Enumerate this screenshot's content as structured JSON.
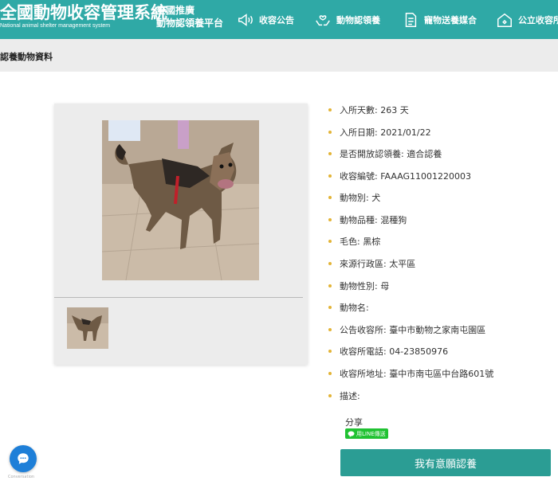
{
  "header": {
    "brand_title": "全國動物收容管理系統",
    "brand_subtitle": "National animal shelter management system",
    "slogan_line1": "全國推廣",
    "slogan_line2": "動物認領養平台",
    "nav": [
      {
        "label": "收容公告",
        "icon": "megaphone-icon"
      },
      {
        "label": "動物認領養",
        "icon": "hands-heart-icon"
      },
      {
        "label": "寵物送養媒合",
        "icon": "document-icon"
      },
      {
        "label": "公立收容所",
        "icon": "house-icon"
      }
    ],
    "colors": {
      "header_bg": "#2fa9a6",
      "button_bg": "#2b9d94",
      "bullet": "#e3b437",
      "line_green": "#20c232"
    }
  },
  "page": {
    "section_title": "認養動物資料"
  },
  "animal": {
    "fields": [
      {
        "label": "入所天數:",
        "value": "263 天"
      },
      {
        "label": "入所日期:",
        "value": "2021/01/22"
      },
      {
        "label": "是否開放認領養:",
        "value": "適合認養"
      },
      {
        "label": "收容編號:",
        "value": "FAAAG11001220003"
      },
      {
        "label": "動物別:",
        "value": "犬"
      },
      {
        "label": "動物品種:",
        "value": "混種狗"
      },
      {
        "label": "毛色:",
        "value": "黑棕"
      },
      {
        "label": "來源行政區:",
        "value": "太平區"
      },
      {
        "label": "動物性別:",
        "value": "母"
      },
      {
        "label": "動物名:",
        "value": ""
      },
      {
        "label": "公告收容所:",
        "value": "臺中市動物之家南屯園區"
      },
      {
        "label": "收容所電話:",
        "value": "04-23850976"
      },
      {
        "label": "收容所地址:",
        "value": "臺中市南屯區中台路601號"
      },
      {
        "label": "描述:",
        "value": ""
      }
    ]
  },
  "share": {
    "label": "分享",
    "line_button": "用LINE傳送"
  },
  "actions": {
    "adopt_label": "我有意願認養"
  },
  "chat": {
    "caption": "Conversation"
  }
}
